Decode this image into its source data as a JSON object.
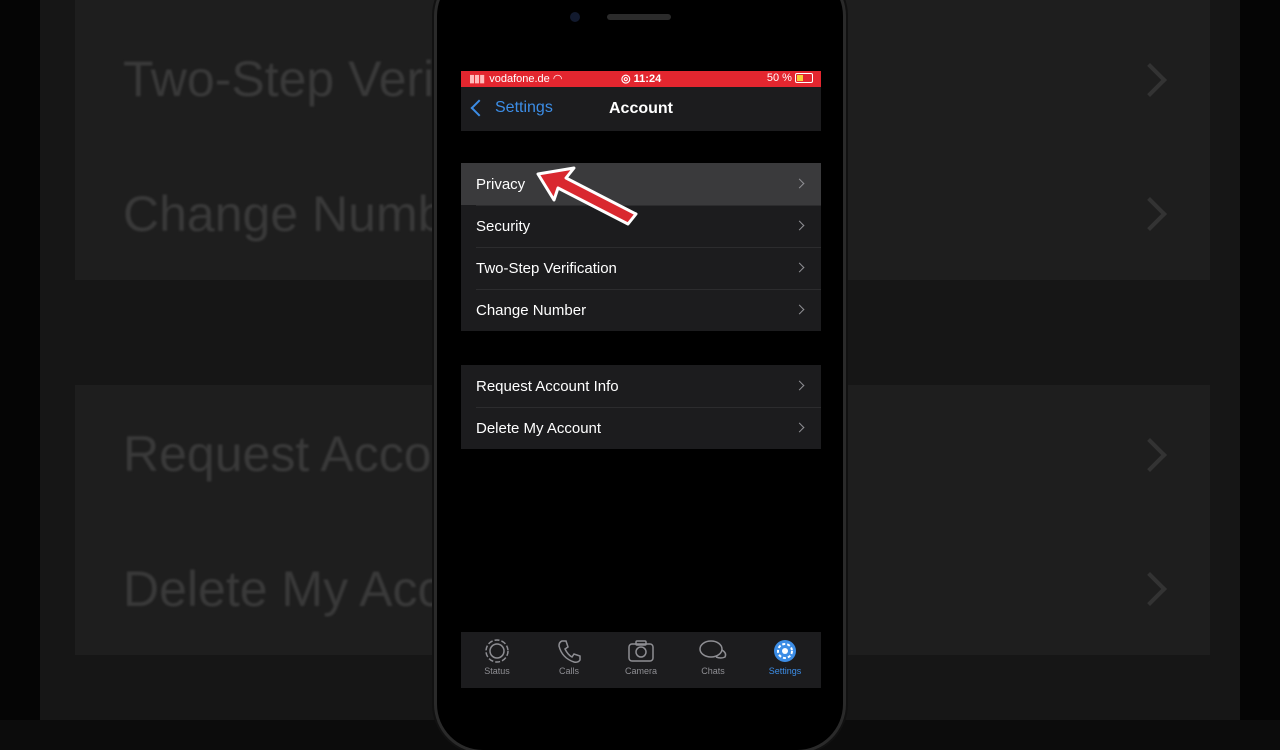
{
  "background": {
    "items": [
      "Two-Step Verification",
      "Change Number",
      "Request Account Info",
      "Delete My Account"
    ]
  },
  "statusbar": {
    "carrier": "vodafone.de",
    "time": "11:24",
    "battery": "50 %"
  },
  "nav": {
    "back_label": "Settings",
    "title": "Account"
  },
  "group1": [
    {
      "label": "Privacy"
    },
    {
      "label": "Security"
    },
    {
      "label": "Two-Step Verification"
    },
    {
      "label": "Change Number"
    }
  ],
  "group2": [
    {
      "label": "Request Account Info"
    },
    {
      "label": "Delete My Account"
    }
  ],
  "tabbar": [
    {
      "label": "Status",
      "icon": "status-icon"
    },
    {
      "label": "Calls",
      "icon": "phone-icon"
    },
    {
      "label": "Camera",
      "icon": "camera-icon"
    },
    {
      "label": "Chats",
      "icon": "chat-bubbles-icon"
    },
    {
      "label": "Settings",
      "icon": "gear-icon",
      "active": true
    }
  ],
  "colors": {
    "accent": "#3c8de6",
    "statusbar": "#e3262f",
    "arrow": "#d9282f"
  }
}
